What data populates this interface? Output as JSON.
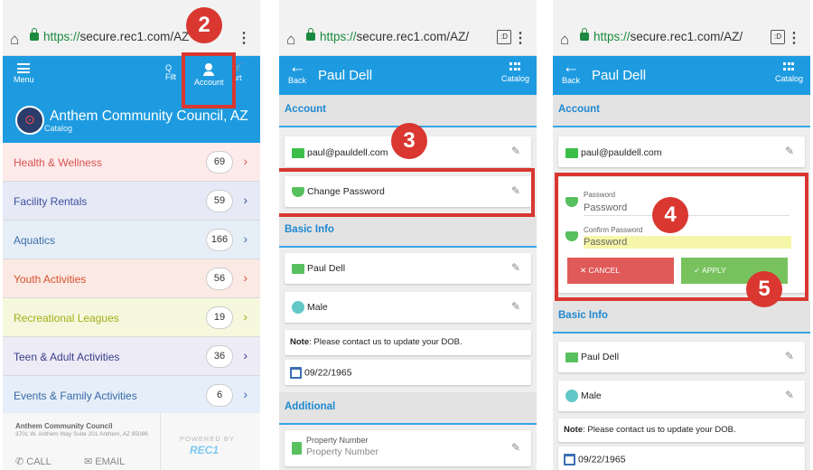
{
  "url_scheme": "https://",
  "url_host_p1": "secure.rec1.com/AZ",
  "url_host": "secure.rec1.com/AZ/",
  "phone1": {
    "menu_label": "Menu",
    "filter_label": "Filt",
    "account_label": "Account",
    "cart_label": "art",
    "org_name": "Anthem Community Council, AZ",
    "org_sub": "Catalog",
    "categories": [
      {
        "label": "Health & Wellness",
        "count": "69",
        "bg": "#fdebea",
        "color": "#d9534f"
      },
      {
        "label": "Facility Rentals",
        "count": "59",
        "bg": "#e7eaf6",
        "color": "#3b4f9e"
      },
      {
        "label": "Aquatics",
        "count": "166",
        "bg": "#e6eef7",
        "color": "#3b6fa8"
      },
      {
        "label": "Youth Activities",
        "count": "56",
        "bg": "#fbe9e4",
        "color": "#d8512f"
      },
      {
        "label": "Recreational Leagues",
        "count": "19",
        "bg": "#f5f8dc",
        "color": "#a4ad1c"
      },
      {
        "label": "Teen & Adult Activities",
        "count": "36",
        "bg": "#ecebf6",
        "color": "#3a3d8c"
      },
      {
        "label": "Events & Family Activities",
        "count": "6",
        "bg": "#e6eff9",
        "color": "#3667a6"
      }
    ],
    "footer_name": "Anthem Community Council",
    "footer_addr": "3701 W. Anthem Way Suite 201 Anthem, AZ 85086",
    "call_label": "CALL",
    "email_label": "EMAIL",
    "powered": "POWERED BY",
    "rec": "REC1"
  },
  "account_screen": {
    "back_label": "Back",
    "title": "Paul Dell",
    "catalog_label": "Catalog",
    "section_account": "Account",
    "email": "paul@pauldell.com",
    "change_password": "Change Password",
    "section_basic": "Basic Info",
    "name": "Paul Dell",
    "gender": "Male",
    "dob_note_bold": "Note",
    "dob_note": ": Please contact us to update your DOB.",
    "dob": "09/22/1965",
    "section_additional": "Additional",
    "property_label": "Property Number",
    "property_placeholder": "Property Number"
  },
  "password_form": {
    "password_label": "Password",
    "password_placeholder": "Password",
    "confirm_label": "Confirm Password",
    "confirm_placeholder": "Password",
    "cancel": "CANCEL",
    "apply": "APPLY"
  },
  "steps": {
    "s2": "2",
    "s3": "3",
    "s4": "4",
    "s5": "5"
  },
  "colors": {
    "accent": "#1e9be0",
    "annotation": "#d93730",
    "cancel": "#e05a5a",
    "apply": "#78c25e"
  }
}
